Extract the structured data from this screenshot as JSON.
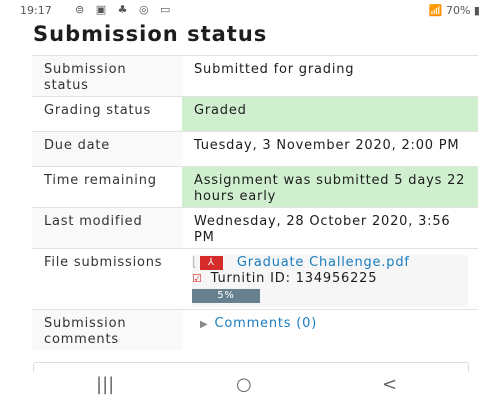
{
  "status_bar": {
    "time": "19:17",
    "notification_icons": "⊜ ▣ ♣ ◎ ▭",
    "signal": "70%"
  },
  "title": "Submission status",
  "rows": [
    {
      "label": "Submission status",
      "value": "Submitted for grading"
    },
    {
      "label": "Grading status",
      "value": "Graded"
    },
    {
      "label": "Due date",
      "value": "Tuesday, 3 November 2020, 2:00 PM"
    },
    {
      "label": "Time remaining",
      "value": "Assignment was submitted 5 days 22 hours early"
    },
    {
      "label": "Last modified",
      "value": "Wednesday, 28 October 2020, 3:56 PM"
    },
    {
      "label": "File submissions",
      "file": "Graduate Challenge.pdf",
      "turnitin": "Turnitin ID: 134956225",
      "similarity": "5%"
    },
    {
      "label": "Submission comments",
      "comments": "Comments (0)"
    }
  ],
  "nav": {
    "recent": "|||",
    "home": "○",
    "back": "<"
  }
}
